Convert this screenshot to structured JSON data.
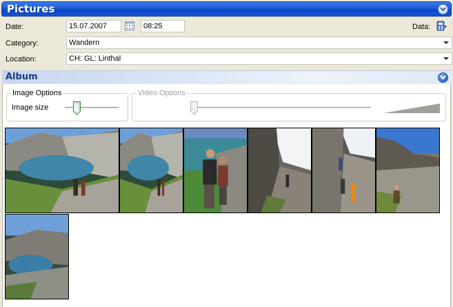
{
  "window": {
    "title": "Pictures"
  },
  "form": {
    "date_label": "Date:",
    "date_value": "15.07.2007",
    "time_value": "08:25",
    "data_label": "Data:",
    "category_label": "Category:",
    "category_value": "Wandern",
    "location_label": "Location:",
    "location_value": "CH: GL: Linthal"
  },
  "album": {
    "title": "Album",
    "image_options": {
      "legend": "Image Options",
      "size_label": "Image size",
      "size_level": 0.25
    },
    "video_options": {
      "legend": "Video Options"
    },
    "photos": [
      {
        "scene": "lake-hikers"
      },
      {
        "scene": "lake-hikers"
      },
      {
        "scene": "hikers-portrait"
      },
      {
        "scene": "rock-climb"
      },
      {
        "scene": "rock-climb-group"
      },
      {
        "scene": "cliff-hiker"
      },
      {
        "scene": "lake-valley"
      }
    ]
  },
  "colors": {
    "titlebar": "#1d5cd6",
    "album_header_text": "#1c3b82",
    "background": "#ece9d8"
  },
  "icons": [
    "collapse-icon",
    "calendar-icon",
    "data-icon",
    "chevron-down-icon",
    "album-collapse-icon"
  ]
}
